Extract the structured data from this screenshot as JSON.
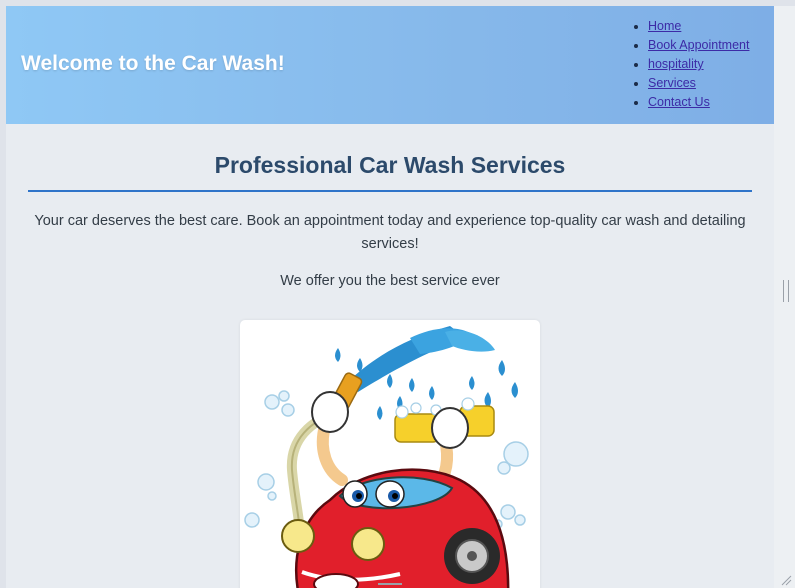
{
  "header": {
    "title": "Welcome to the Car Wash!"
  },
  "nav": {
    "items": [
      {
        "label": "Home"
      },
      {
        "label": "Book Appointment"
      },
      {
        "label": "hospitality"
      },
      {
        "label": "Services"
      },
      {
        "label": "Contact Us"
      }
    ]
  },
  "main": {
    "heading": "Professional Car Wash Services",
    "lead": "Your car deserves the best care. Book an appointment today and experience top-quality car wash and detailing services!",
    "tagline": "We offer you the best service ever"
  },
  "colors": {
    "header_gradient_start": "#8fc8f5",
    "header_gradient_end": "#7eaee6",
    "heading": "#2c4a6b",
    "rule": "#2f74c9",
    "link": "#3c2ba6",
    "car_body": "#e11f2b",
    "water": "#2b8fd0"
  }
}
